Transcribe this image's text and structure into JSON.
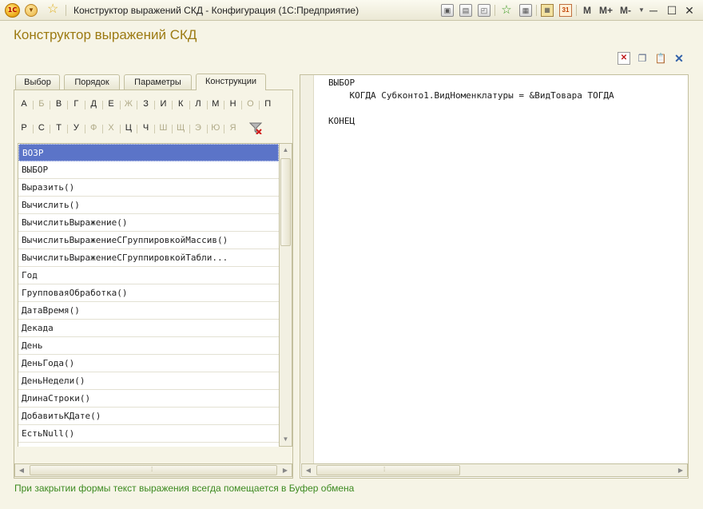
{
  "window": {
    "title": "Конструктор выражений СКД - Конфигурация  (1С:Предприятие)",
    "logo_text": "1С",
    "memory_buttons": [
      "M",
      "M+",
      "M-"
    ]
  },
  "form": {
    "title": "Конструктор выражений СКД"
  },
  "tabs": [
    {
      "label": "Выбор"
    },
    {
      "label": "Порядок"
    },
    {
      "label": "Параметры"
    },
    {
      "label": "Конструкции",
      "active": true
    }
  ],
  "alphabet": {
    "row1": [
      "А",
      "Б",
      "В",
      "Г",
      "Д",
      "Е",
      "Ж",
      "З",
      "И",
      "К",
      "Л",
      "М",
      "Н",
      "О",
      "П"
    ],
    "row2": [
      "Р",
      "С",
      "Т",
      "У",
      "Ф",
      "Х",
      "Ц",
      "Ч",
      "Ш",
      "Щ",
      "Э",
      "Ю",
      "Я"
    ],
    "row1_dimmed": [
      1,
      6,
      13
    ],
    "row2_dimmed": [
      4,
      5,
      8,
      9,
      10,
      11,
      12
    ]
  },
  "constructs": [
    "ВОЗР",
    "ВЫБОР",
    "Выразить()",
    "Вычислить()",
    "ВычислитьВыражение()",
    "ВычислитьВыражениеСГруппировкойМассив()",
    "ВычислитьВыражениеСГруппировкойТабли...",
    "Год",
    "ГрупповаяОбработка()",
    "ДатаВремя()",
    "Декада",
    "День",
    "ДеньГода()",
    "ДеньНедели()",
    "ДлинаСтроки()",
    "ДобавитьКДате()",
    "ЕстьNull()"
  ],
  "selected_construct": "ВОЗР",
  "editor": {
    "lines": [
      "ВЫБОР",
      "    КОГДА Субконто1.ВидНоменклатуры = &ВидТовара ТОГДА",
      "",
      "КОНЕЦ"
    ]
  },
  "footer": {
    "message": "При закрытии формы текст выражения всегда помещается в Буфер обмена"
  },
  "colors": {
    "background": "#f6f4e6",
    "title_accent": "#9c7a12",
    "selection": "#5b74c8",
    "footer_text": "#3c8a20"
  },
  "icons": {
    "titlebar": [
      "logo-icon",
      "menu-dropdown-icon",
      "favorite-star-icon",
      "save-icon",
      "print-icon",
      "preview-icon",
      "add-favorite-icon",
      "history-icon",
      "calculator-icon",
      "calendar-icon"
    ],
    "commands": [
      "delete-icon",
      "copy-icon",
      "paste-icon",
      "close-icon"
    ],
    "filter": "clear-filter-icon"
  }
}
